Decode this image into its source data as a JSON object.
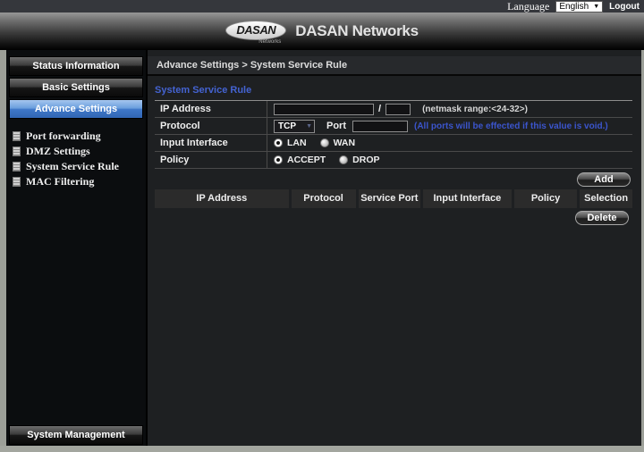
{
  "topbar": {
    "language_label": "Language",
    "language_value": "English",
    "logout_label": "Logout"
  },
  "header": {
    "logo_word": "DASAN",
    "logo_sub": "Networks",
    "brand": "DASAN Networks"
  },
  "sidebar": {
    "sections": [
      {
        "label": "Status Information",
        "active": false
      },
      {
        "label": "Basic Settings",
        "active": false
      },
      {
        "label": "Advance Settings",
        "active": true
      }
    ],
    "subitems": [
      {
        "label": "Port forwarding"
      },
      {
        "label": "DMZ Settings"
      },
      {
        "label": "System Service Rule"
      },
      {
        "label": "MAC Filtering"
      }
    ],
    "bottom": {
      "label": "System Management"
    }
  },
  "breadcrumb": "Advance Settings > System Service Rule",
  "main": {
    "title": "System Service Rule",
    "form": {
      "ip": {
        "label": "IP Address",
        "value": "",
        "separator": "/",
        "netmask_value": "",
        "note": "(netmask range:<24-32>)"
      },
      "protocol": {
        "label": "Protocol",
        "selected": "TCP",
        "port_label": "Port",
        "port_value": "",
        "note": "(All ports will be effected if this value is void.)"
      },
      "interface": {
        "label": "Input Interface",
        "options": [
          {
            "label": "LAN",
            "selected": true
          },
          {
            "label": "WAN",
            "selected": false
          }
        ]
      },
      "policy": {
        "label": "Policy",
        "options": [
          {
            "label": "ACCEPT",
            "selected": true
          },
          {
            "label": "DROP",
            "selected": false
          }
        ]
      }
    },
    "add_button": "Add",
    "delete_button": "Delete",
    "table": {
      "headers": [
        "IP Address",
        "Protocol",
        "Service Port",
        "Input Interface",
        "Policy",
        "Selection"
      ],
      "rows": []
    }
  },
  "icons": {
    "dropdown_arrow": "▼",
    "select_arrow": "▼"
  },
  "colors": {
    "title_blue": "#4463d2",
    "note_blue": "#3b55cd",
    "active_nav_blue": "#3f77c8",
    "page_bg": "#1e2022",
    "sidebar_bg": "#0b0d0f"
  }
}
